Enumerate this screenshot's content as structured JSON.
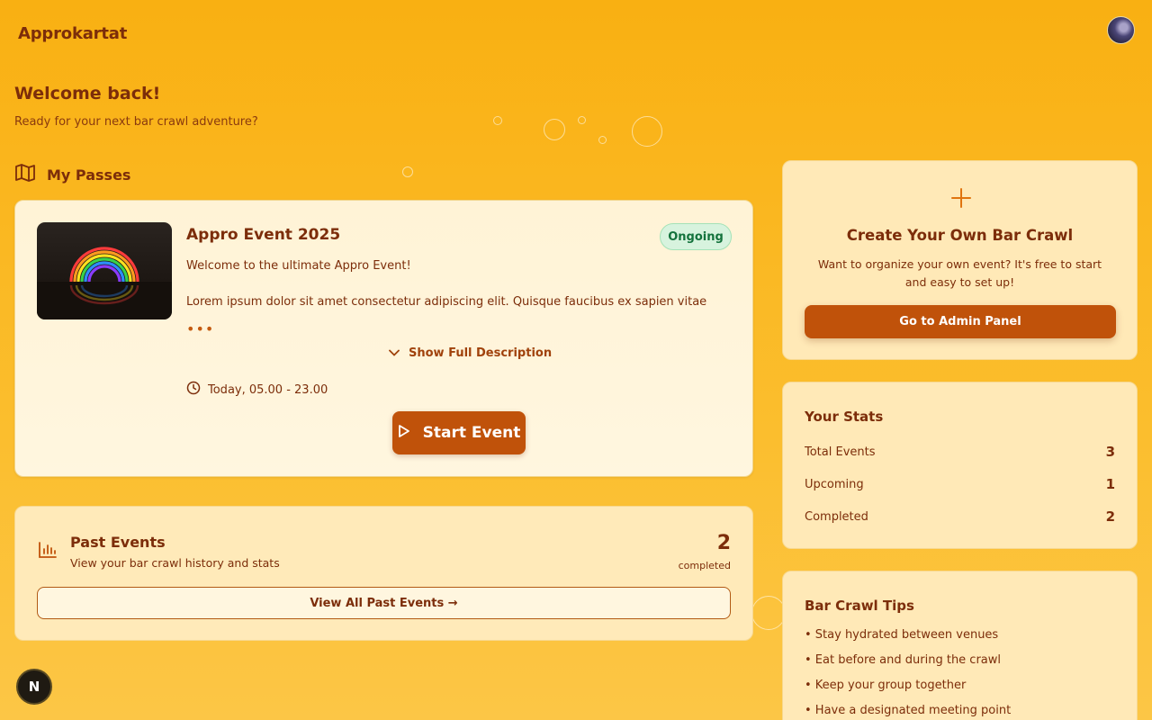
{
  "header": {
    "brand": "Approkartat",
    "avatar_icon": "user-avatar"
  },
  "welcome": {
    "title": "Welcome back!",
    "subtitle": "Ready for your next bar crawl adventure?"
  },
  "passes": {
    "section_label": "My Passes",
    "section_icon": "map-icon",
    "event": {
      "title": "Appro Event 2025",
      "status": "Ongoing",
      "description_line1": "Welcome to the ultimate Appro Event!",
      "description_line2": "Lorem ipsum dolor sit amet consectetur adipiscing elit. Quisque faucibus ex sapien vitae",
      "ellipsis": "•••",
      "show_full_label": "Show Full Description",
      "date": "Today, 05.00 - 23.00",
      "start_label": "Start Event"
    }
  },
  "past_events": {
    "title": "Past Events",
    "subtitle": "View your bar crawl history and stats",
    "count": "2",
    "count_label": "completed",
    "button_label": "View All Past Events →"
  },
  "create": {
    "icon": "+",
    "title": "Create Your Own Bar Crawl",
    "text": "Want to organize your own event? It's free to start and easy to set up!",
    "button_label": "Go to Admin Panel"
  },
  "stats": {
    "title": "Your Stats",
    "rows": [
      {
        "label": "Total Events",
        "value": "3"
      },
      {
        "label": "Upcoming",
        "value": "1"
      },
      {
        "label": "Completed",
        "value": "2"
      }
    ]
  },
  "tips": {
    "title": "Bar Crawl Tips",
    "items": [
      "• Stay hydrated between venues",
      "• Eat before and during the crawl",
      "• Keep your group together",
      "• Have a designated meeting point"
    ]
  },
  "dev_badge": {
    "label": "N"
  },
  "colors": {
    "accent": "#c0520a",
    "text": "#7c2d0a",
    "badge_green": "#13723c",
    "background": "#f9b012"
  }
}
